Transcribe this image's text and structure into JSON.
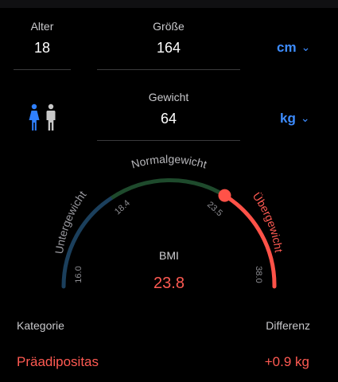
{
  "fields": {
    "age": {
      "label": "Alter",
      "value": "18"
    },
    "height": {
      "label": "Größe",
      "value": "164"
    },
    "weight": {
      "label": "Gewicht",
      "value": "64"
    }
  },
  "units": {
    "height_unit": "cm",
    "weight_unit": "kg",
    "chevron": "⌄"
  },
  "gender_icons": [
    "female-figure-icon",
    "male-figure-icon"
  ],
  "colors": {
    "female": "#2f80ff",
    "male": "#c8c8c8",
    "underweight": "#1b3f5c",
    "normal": "#1e4a2c",
    "overweight": "#ff5248",
    "accent": "#3d8cff"
  },
  "gauge": {
    "zones": {
      "under": "Untergewicht",
      "normal": "Normalgewicht",
      "over": "Übergewicht"
    },
    "ticks": {
      "t1": "16.0",
      "t2": "18.4",
      "t3": "23.5",
      "t4": "38.0"
    },
    "bmi_label": "BMI",
    "bmi_value": "23.8",
    "bmi_number": 23.8
  },
  "footer": {
    "category_label": "Kategorie",
    "category_value": "Präadipositas",
    "difference_label": "Differenz",
    "difference_value": "+0.9 kg"
  }
}
